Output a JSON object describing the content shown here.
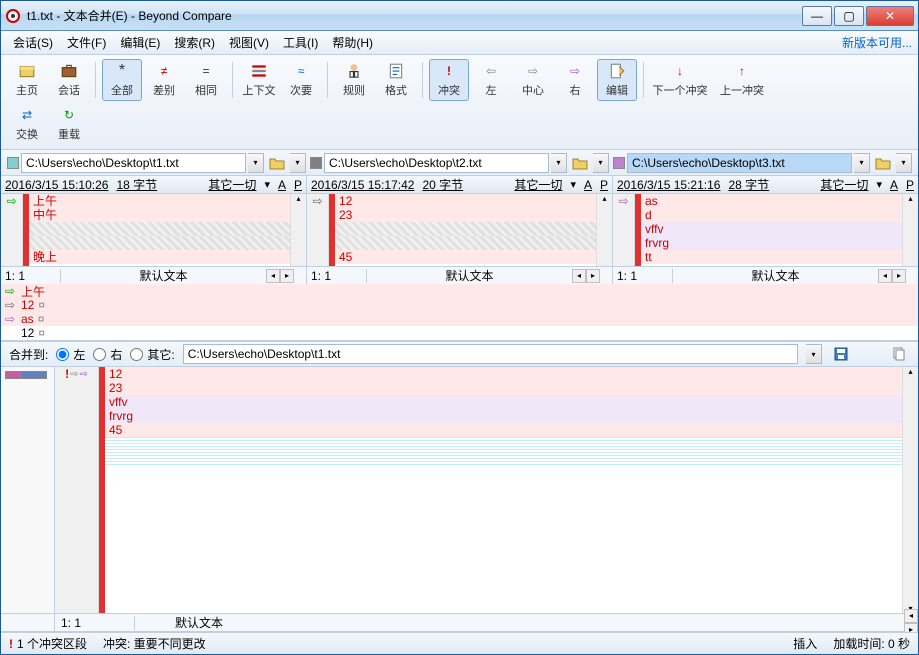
{
  "window": {
    "title": "t1.txt - 文本合并(E) - Beyond Compare"
  },
  "menu": {
    "session": "会话(S)",
    "file": "文件(F)",
    "edit": "编辑(E)",
    "search": "搜索(R)",
    "view": "视图(V)",
    "tools": "工具(I)",
    "help": "帮助(H)",
    "new_version": "新版本可用..."
  },
  "toolbar": {
    "home": "主页",
    "sessions": "会话",
    "all": "全部",
    "diffs": "差别",
    "same": "相同",
    "context": "上下文",
    "minor": "次要",
    "rules": "规则",
    "format": "格式",
    "conflict": "冲突",
    "left": "左",
    "center": "中心",
    "right": "右",
    "edit": "编辑",
    "next_conflict": "下一个冲突",
    "prev_conflict": "上一冲突",
    "swap": "交换",
    "reload": "重载"
  },
  "paths": {
    "left": "C:\\Users\\echo\\Desktop\\t1.txt",
    "center": "C:\\Users\\echo\\Desktop\\t2.txt",
    "right": "C:\\Users\\echo\\Desktop\\t3.txt"
  },
  "panes": {
    "left": {
      "date": "2016/3/15 15:10:26",
      "size": "18 字节",
      "filter": "其它一切",
      "a": "A",
      "p": "P",
      "lines": [
        "上午",
        "中午",
        "",
        "",
        "晚上"
      ],
      "pos": "1: 1",
      "encoding": "默认文本"
    },
    "center": {
      "date": "2016/3/15 15:17:42",
      "size": "20 字节",
      "filter": "其它一切",
      "a": "A",
      "p": "P",
      "lines": [
        "12",
        "23",
        "",
        "",
        "45"
      ],
      "pos": "1: 1",
      "encoding": "默认文本"
    },
    "right": {
      "date": "2016/3/15 15:21:16",
      "size": "28 字节",
      "filter": "其它一切",
      "a": "A",
      "p": "P",
      "lines": [
        "as",
        "d",
        "vffv",
        "frvrg",
        "tt"
      ],
      "pos": "1: 1",
      "encoding": "默认文本"
    }
  },
  "diff_rows": [
    {
      "marker": "⇨",
      "text": "上午",
      "class": "pink"
    },
    {
      "marker": "⇨",
      "text": "12",
      "class": "pink",
      "suffix": "¤"
    },
    {
      "marker": "⇨",
      "text": "as",
      "class": "pink",
      "suffix": "¤"
    },
    {
      "marker": "",
      "text": "12",
      "class": "plain",
      "suffix": "¤"
    }
  ],
  "merge": {
    "label": "合并到:",
    "opt_left": "左",
    "opt_right": "右",
    "opt_other": "其它:",
    "path": "C:\\Users\\echo\\Desktop\\t1.txt",
    "lines": [
      {
        "text": "12",
        "bg": "bg-pink"
      },
      {
        "text": "23",
        "bg": "bg-pink"
      },
      {
        "text": "vffv",
        "bg": "bg-lav"
      },
      {
        "text": "frvrg",
        "bg": "bg-lav"
      },
      {
        "text": "45",
        "bg": "bg-pink"
      }
    ],
    "pos": "1: 1",
    "encoding": "默认文本"
  },
  "status": {
    "conflicts": "1 个冲突区段",
    "conflict_label": "冲突: 重要不同更改",
    "insert": "插入",
    "load_time": "加载时间: 0 秒"
  },
  "colors": {
    "left": "#80d0d0",
    "center": "#808080",
    "right": "#c080d0"
  }
}
